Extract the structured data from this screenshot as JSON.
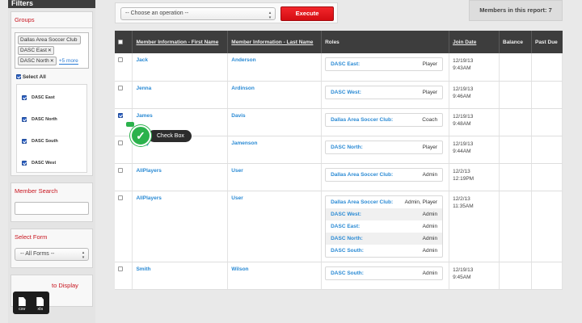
{
  "sidebar": {
    "title": "Filters",
    "groups": {
      "title": "Groups",
      "tags": [
        {
          "label": "Dallas Area Soccer Club"
        },
        {
          "label": "DASC East"
        },
        {
          "label": "DASC North"
        }
      ],
      "more_link": "+5 more",
      "select_all": "Select All",
      "items": [
        {
          "label": "DASC East",
          "checked": true
        },
        {
          "label": "DASC North",
          "checked": true
        },
        {
          "label": "DASC South",
          "checked": true
        },
        {
          "label": "DASC West",
          "checked": true
        }
      ]
    },
    "member_search": {
      "title": "Member Search",
      "value": ""
    },
    "select_form": {
      "title": "Select Form",
      "selected": "-- All Forms --"
    },
    "display": {
      "title": "to Display"
    }
  },
  "toolbar": {
    "operation_placeholder": "-- Choose an operation --",
    "execute_label": "Execute"
  },
  "members_count": "Members in this report: 7",
  "table": {
    "headers": {
      "first": "Member Information - First Name",
      "last": "Member Information - Last Name",
      "roles": "Roles",
      "join": "Join Date",
      "balance": "Balance",
      "past_due": "Past Due"
    },
    "rows": [
      {
        "first": "Jack",
        "last": "Anderson",
        "date": "12/19/13",
        "time": "9:43AM",
        "checked": false,
        "roles": [
          {
            "org": "DASC East:",
            "role": "Player"
          }
        ]
      },
      {
        "first": "Jenna",
        "last": "Ardinson",
        "date": "12/19/13",
        "time": "9:46AM",
        "checked": false,
        "roles": [
          {
            "org": "DASC West:",
            "role": "Player"
          }
        ]
      },
      {
        "first": "James",
        "last": "Davis",
        "date": "12/19/13",
        "time": "9:48AM",
        "checked": true,
        "roles": [
          {
            "org": "Dallas Area Soccer Club:",
            "role": "Coach"
          }
        ]
      },
      {
        "first": "Cody",
        "last": "Jamenson",
        "date": "12/19/13",
        "time": "9:44AM",
        "checked": false,
        "roles": [
          {
            "org": "DASC North:",
            "role": "Player"
          }
        ]
      },
      {
        "first": "AllPlayers",
        "last": "User",
        "date": "12/2/13",
        "time": "12:19PM",
        "checked": false,
        "roles": [
          {
            "org": "Dallas Area Soccer Club:",
            "role": "Admin"
          }
        ]
      },
      {
        "first": "AllPlayers",
        "last": "User",
        "date": "12/2/13",
        "time": "11:35AM",
        "checked": false,
        "roles": [
          {
            "org": "Dallas Area Soccer Club:",
            "role": "Admin, Player"
          },
          {
            "org": "DASC West:",
            "role": "Admin"
          },
          {
            "org": "DASC East:",
            "role": "Admin"
          },
          {
            "org": "DASC North:",
            "role": "Admin"
          },
          {
            "org": "DASC South:",
            "role": "Admin"
          }
        ]
      },
      {
        "first": "Smith",
        "last": "Wilson",
        "date": "12/19/13",
        "time": "9:45AM",
        "checked": false,
        "roles": [
          {
            "org": "DASC South:",
            "role": "Admin"
          }
        ]
      }
    ]
  },
  "tooltip": {
    "label": "Check Box"
  },
  "exports": [
    {
      "label": "csv"
    },
    {
      "label": "xls"
    }
  ]
}
